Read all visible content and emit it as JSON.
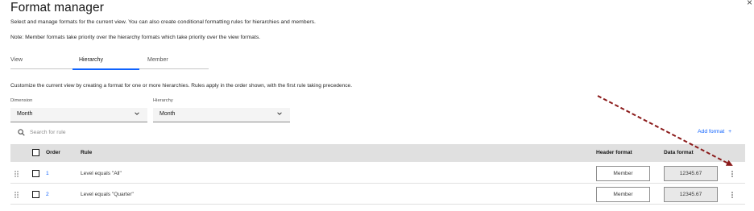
{
  "dialog": {
    "title": "Format manager",
    "close_glyph": "×",
    "description": "Select and manage formats for the current view. You can also create conditional formatting rules for hierarchies and members.",
    "note": "Note: Member formats take priority over the hierarchy formats which take priority over the view formats."
  },
  "tabs": [
    {
      "label": "View",
      "selected": false
    },
    {
      "label": "Hierarchy",
      "selected": true
    },
    {
      "label": "Member",
      "selected": false
    }
  ],
  "instructions": "Customize the current view by creating a format for one or more hierarchies. Rules apply in the order shown, with the first rule taking precedence.",
  "dimension": {
    "label": "Dimension",
    "value": "Month"
  },
  "hierarchy": {
    "label": "Hierarchy",
    "value": "Month"
  },
  "search": {
    "placeholder": "Search for rule"
  },
  "add_format": {
    "label": "Add format",
    "glyph": "+"
  },
  "table": {
    "headers": {
      "order": "Order",
      "rule": "Rule",
      "header_format": "Header format",
      "data_format": "Data format"
    },
    "rows": [
      {
        "order": "1",
        "rule": "Level equals \"All\"",
        "header_format": "Member",
        "data_format": "12345.67"
      },
      {
        "order": "2",
        "rule": "Level equals \"Quarter\"",
        "header_format": "Member",
        "data_format": "12345.67"
      }
    ]
  },
  "colors": {
    "accent": "#0f62fe",
    "annotation_arrow": "#8b1a1a",
    "header_bg": "#e0e0e0"
  },
  "icons": [
    "close-icon",
    "chevron-down-icon",
    "search-icon",
    "add-icon",
    "drag-handle-icon",
    "overflow-menu-icon"
  ]
}
